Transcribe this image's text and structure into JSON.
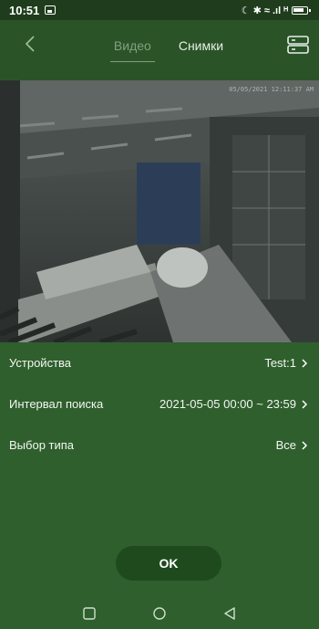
{
  "status_bar": {
    "time": "10:51",
    "right_icons": "☾ ✱ ≈ .ıl ᴴ"
  },
  "header": {
    "tabs": [
      {
        "label": "Видео",
        "active": true
      },
      {
        "label": "Снимки",
        "active": false
      }
    ]
  },
  "video": {
    "timestamp": "05/05/2021 12:11:37 AM"
  },
  "settings": [
    {
      "label": "Устройства",
      "value": "Test:1"
    },
    {
      "label": "Интервал поиска",
      "value": "2021-05-05 00:00 ~ 23:59"
    },
    {
      "label": "Выбор типа",
      "value": "Все"
    }
  ],
  "ok_label": "OK",
  "colors": {
    "background": "#2f5f2d",
    "header": "#2a5428",
    "button": "#1f4a1e"
  },
  "nav": [
    "square-icon",
    "circle-icon",
    "triangle-back-icon"
  ]
}
